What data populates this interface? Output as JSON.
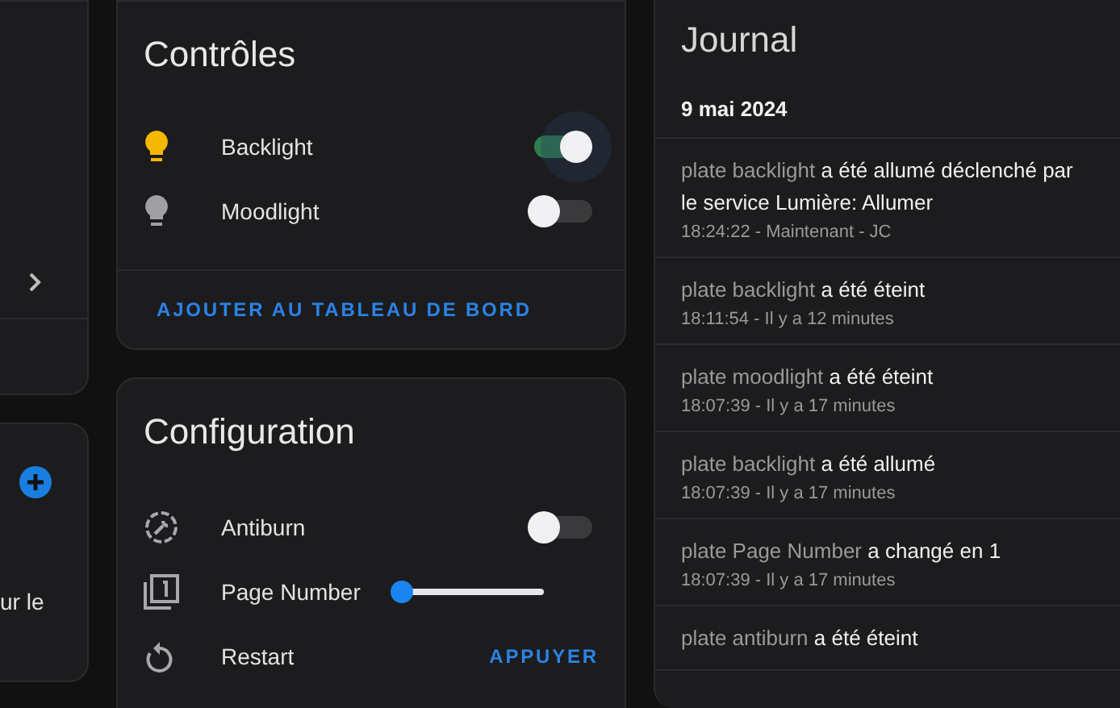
{
  "left_cards": [
    {
      "kind": "chevron"
    },
    {
      "kind": "add",
      "text": "ur le"
    }
  ],
  "controls": {
    "title": "Contrôles",
    "rows": [
      {
        "kind": "light",
        "label": "Backlight",
        "on": true
      },
      {
        "kind": "light",
        "label": "Moodlight",
        "on": false
      }
    ],
    "action": "AJOUTER AU TABLEAU DE BORD"
  },
  "configuration": {
    "title": "Configuration",
    "rows": [
      {
        "kind": "toggle",
        "label": "Antiburn",
        "on": false
      },
      {
        "kind": "slider",
        "label": "Page Number",
        "level": 0
      },
      {
        "kind": "button",
        "label": "Restart",
        "action": "APPUYER"
      }
    ]
  },
  "journal": {
    "title": "Journal",
    "date": "9 mai 2024",
    "entries": [
      {
        "entity": "plate backlight",
        "message": "a été allumé déclenché par le service Lumière: Allumer",
        "time": "18:24:22 - Maintenant - JC"
      },
      {
        "entity": "plate backlight",
        "message": "a été éteint",
        "time": "18:11:54 - Il y a 12 minutes"
      },
      {
        "entity": "plate moodlight",
        "message": "a été éteint",
        "time": "18:07:39 - Il y a 17 minutes"
      },
      {
        "entity": "plate backlight",
        "message": "a été allumé",
        "time": "18:07:39 - Il y a 17 minutes"
      },
      {
        "entity": "plate Page Number",
        "message": "a changé en 1",
        "time": "18:07:39 - Il y a 17 minutes"
      },
      {
        "entity": "plate antiburn",
        "message": "a été éteint"
      }
    ]
  }
}
